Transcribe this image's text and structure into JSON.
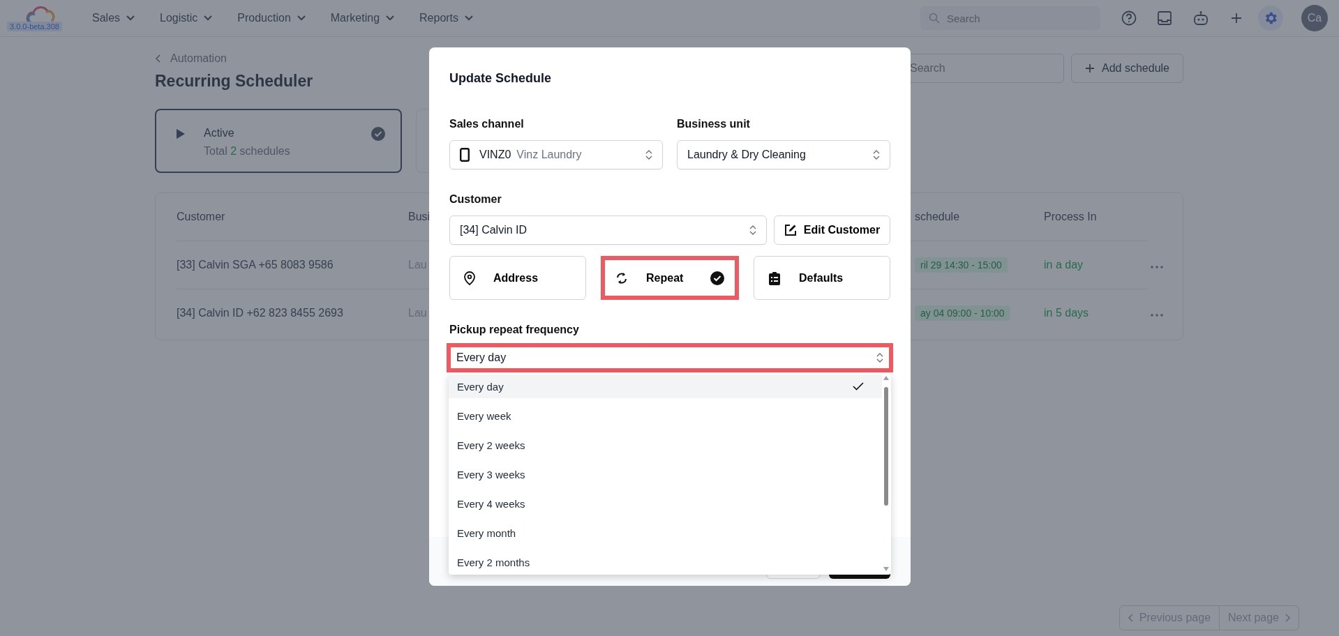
{
  "app": {
    "version": "3.0.0-beta.308"
  },
  "nav": [
    {
      "label": "Sales"
    },
    {
      "label": "Logistic"
    },
    {
      "label": "Production"
    },
    {
      "label": "Marketing"
    },
    {
      "label": "Reports"
    }
  ],
  "topbar": {
    "search": {
      "placeholder": "Search"
    },
    "avatar": "Ca"
  },
  "breadcrumb": "Automation",
  "title": "Recurring Scheduler",
  "search": {
    "placeholder": "Search"
  },
  "add_button": "Add schedule",
  "status_cards": [
    {
      "title": "Active",
      "total": "Total",
      "count": "2",
      "unit": "schedules",
      "selected": true
    }
  ],
  "table": {
    "columns": [
      "Customer",
      "Busi",
      "schedule",
      "Process In"
    ],
    "rows": [
      {
        "customer": "[33] Calvin SGA +65 8083 9586",
        "business": "Lau",
        "schedule": "ril 29 14:30 - 15:00",
        "process_in": "in a day"
      },
      {
        "customer": "[34] Calvin ID +62 823 8455 2693",
        "business": "Lau",
        "schedule": "ay 04 09:00 - 10:00",
        "process_in": "in 5 days"
      }
    ]
  },
  "pagination": {
    "previous": "Previous page",
    "next": "Next page"
  },
  "modal": {
    "title": "Update Schedule",
    "sales_channel": {
      "label": "Sales channel",
      "code": "VINZ0",
      "name": "Vinz Laundry"
    },
    "business_unit": {
      "label": "Business unit",
      "value": "Laundry & Dry Cleaning"
    },
    "customer": {
      "label": "Customer",
      "value": "[34] Calvin ID"
    },
    "edit_customer": "Edit Customer",
    "options": [
      {
        "kind": "address",
        "label": "Address",
        "selected": false,
        "highlighted": false
      },
      {
        "kind": "repeat",
        "label": "Repeat",
        "selected": true,
        "highlighted": true
      },
      {
        "kind": "defaults",
        "label": "Defaults",
        "selected": false,
        "highlighted": false
      }
    ],
    "frequency": {
      "label": "Pickup repeat frequency",
      "value": "Every day",
      "highlighted": true,
      "options": [
        {
          "label": "Every day",
          "selected": true
        },
        {
          "label": "Every week",
          "selected": false
        },
        {
          "label": "Every 2 weeks",
          "selected": false
        },
        {
          "label": "Every 3 weeks",
          "selected": false
        },
        {
          "label": "Every 4 weeks",
          "selected": false
        },
        {
          "label": "Every month",
          "selected": false
        },
        {
          "label": "Every 2 months",
          "selected": false
        }
      ]
    }
  }
}
